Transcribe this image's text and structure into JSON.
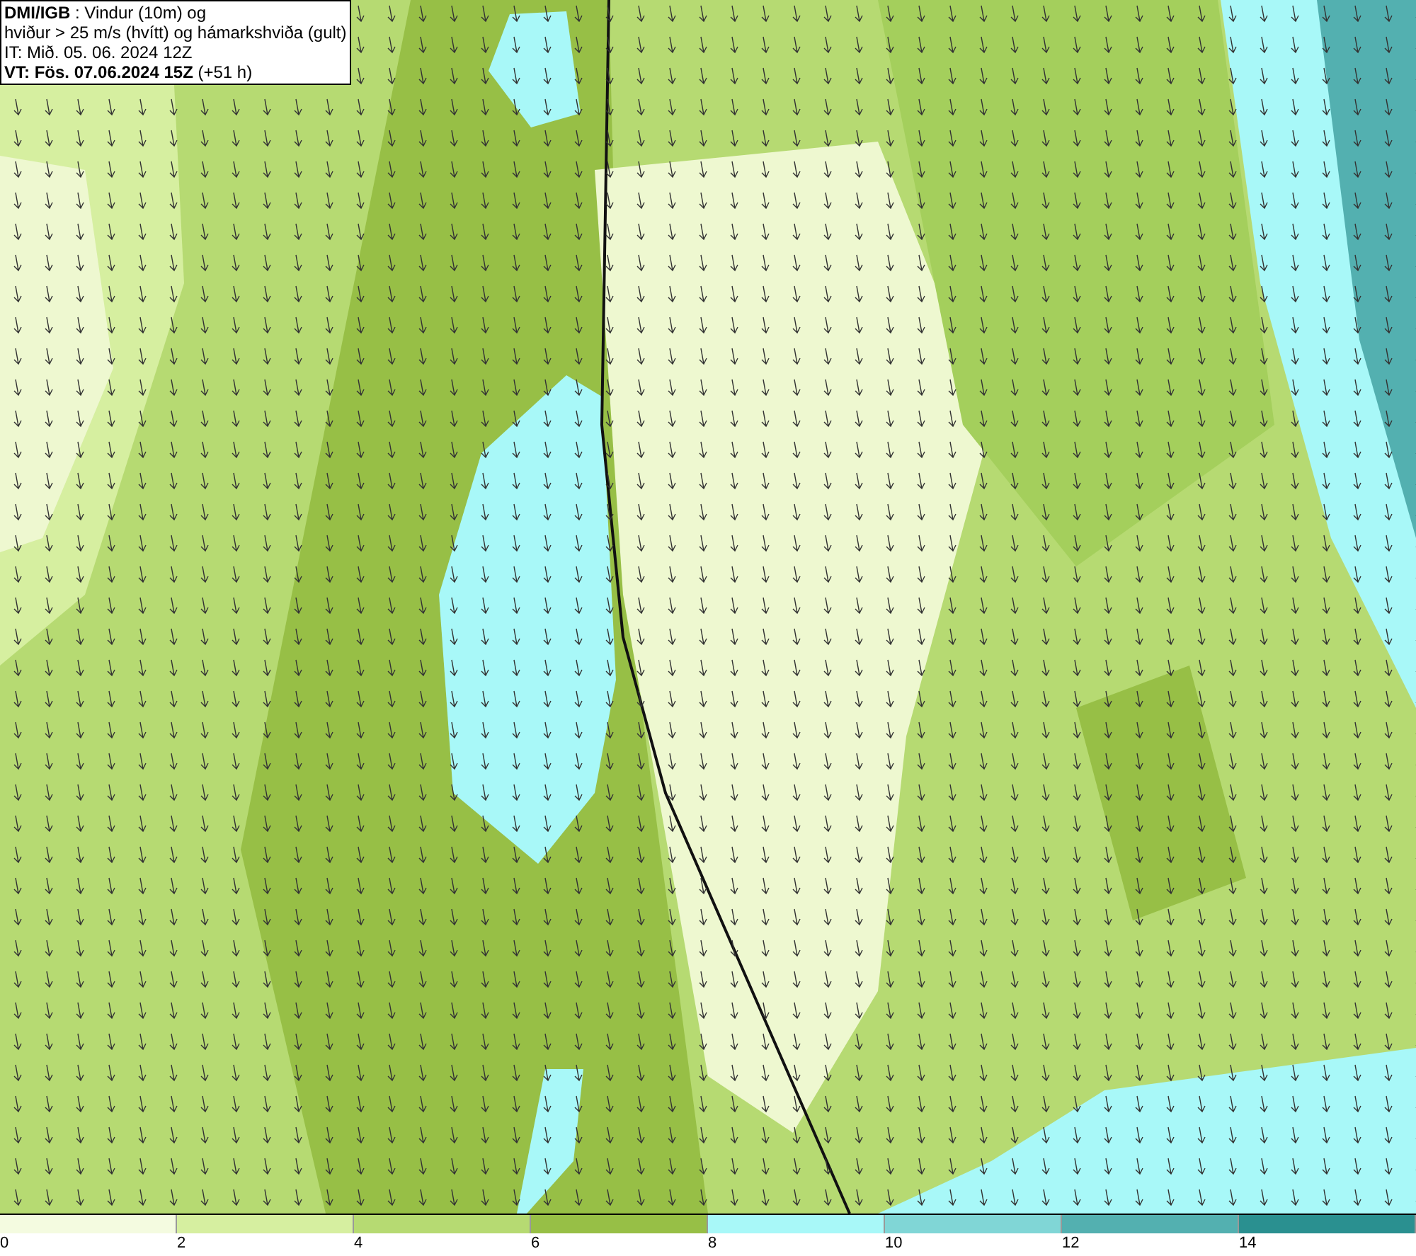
{
  "title_box": {
    "lines": [
      "**DMI/IGB** : Vindur (10m) og",
      "hviður > 25 m/s (hvítt) og hámarkshviða (gult)",
      "IT: Mið. 05. 06. 2024 12Z",
      "**VT: Fös. 07.06.2024 15Z** (+51 h)"
    ]
  },
  "legend": [
    {
      "label": "0",
      "color": "#f4fbe0"
    },
    {
      "label": "2",
      "color": "#d6efa0"
    },
    {
      "label": "4",
      "color": "#b6da72"
    },
    {
      "label": "6",
      "color": "#97bf46"
    },
    {
      "label": "8",
      "color": "#a8f8f8"
    },
    {
      "label": "10",
      "color": "#80d6d6"
    },
    {
      "label": "12",
      "color": "#53b0b0"
    },
    {
      "label": "14",
      "color": "#2a9090"
    }
  ]
}
